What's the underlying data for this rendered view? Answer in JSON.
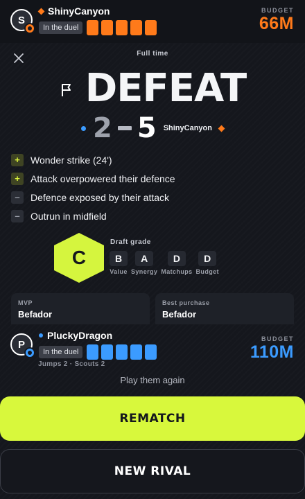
{
  "header_player": {
    "avatar_letter": "S",
    "name": "ShinyCanyon",
    "status": "In the duel",
    "pips": 5,
    "budget_label": "BUDGET",
    "budget_value": "66M",
    "color": "#ff7a1a"
  },
  "result": {
    "subtitle": "Full time",
    "title": "DEFEAT",
    "own_score": "2",
    "opponent_score": "5",
    "opponent_name": "ShinyCanyon",
    "own_color": "#3b9bff",
    "opponent_color": "#ff7a1a"
  },
  "key_points": [
    {
      "marker": "+",
      "type": "pos",
      "text": "Wonder strike (24')"
    },
    {
      "marker": "+",
      "type": "pos",
      "text": "Attack overpowered their defence"
    },
    {
      "marker": "–",
      "type": "neg",
      "text": "Defence exposed by their attack"
    },
    {
      "marker": "–",
      "type": "neg",
      "text": "Outrun in midfield"
    }
  ],
  "grade": {
    "letter": "C",
    "label": "Draft grade",
    "color": "#d5f53e",
    "breakdown": [
      {
        "grade": "B",
        "caption": "Value"
      },
      {
        "grade": "A",
        "caption": "Synergy"
      },
      {
        "grade": "D",
        "caption": "Matchups"
      },
      {
        "grade": "D",
        "caption": "Budget"
      }
    ]
  },
  "stats": {
    "mvp_label": "MVP",
    "mvp_value": "Befador",
    "best_purchase_label": "Best purchase",
    "best_purchase_value": "Befador"
  },
  "self_player": {
    "avatar_letter": "P",
    "name": "PluckyDragon",
    "status": "In the duel",
    "pips": 5,
    "sub_stats": "Jumps 2 · Scouts 2",
    "budget_label": "BUDGET",
    "budget_value": "110M",
    "color": "#3b9bff"
  },
  "actions": {
    "play_again": "Play them again",
    "rematch": "REMATCH",
    "new_rival": "NEW RIVAL"
  }
}
